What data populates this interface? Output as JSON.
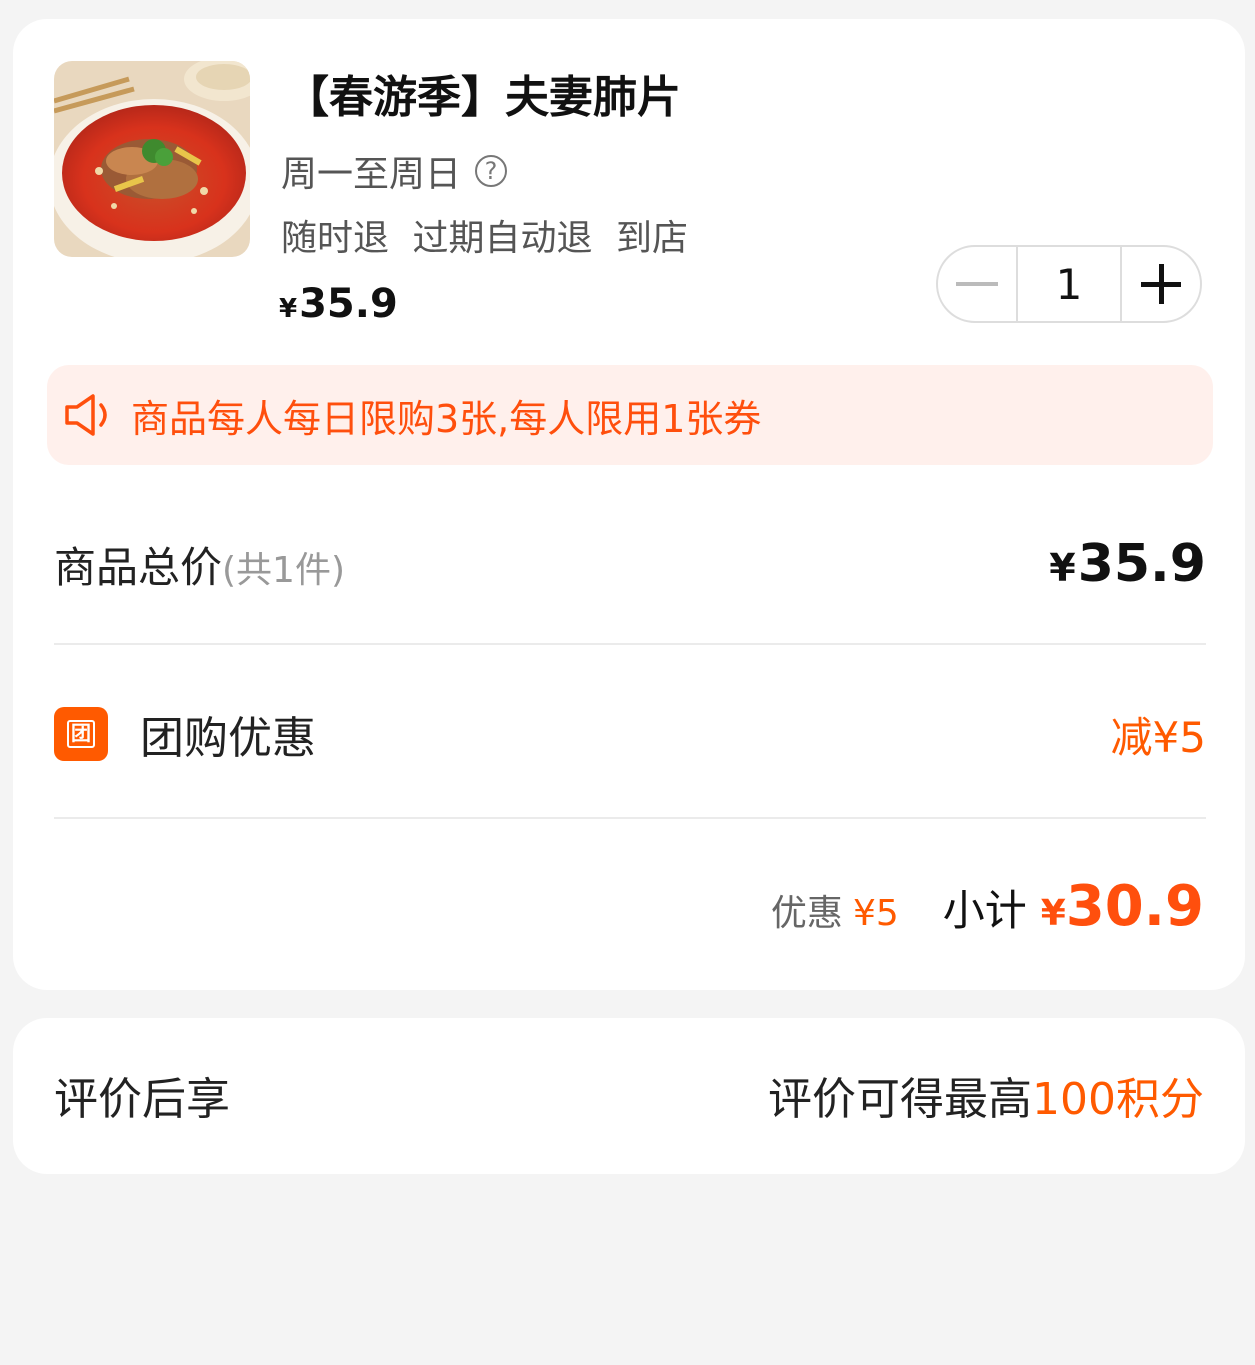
{
  "product": {
    "title": "【春游季】夫妻肺片",
    "validity": "周一至周日",
    "refund_tags": [
      "随时退",
      "过期自动退",
      "到店"
    ],
    "price_symbol": "¥",
    "price": "35.9",
    "quantity": "1",
    "image_icon": "food-photo"
  },
  "notice": {
    "text": "商品每人每日限购3张,每人限用1张券"
  },
  "total": {
    "label": "商品总价",
    "count": "(共1件)",
    "symbol": "¥",
    "value": "35.9"
  },
  "discount": {
    "icon_text": "团",
    "label": "团购优惠",
    "value": "减¥5"
  },
  "subtotal": {
    "discount_label": "优惠",
    "discount_value": "¥5",
    "label": "小计",
    "symbol": "¥",
    "value": "30.9"
  },
  "review": {
    "label": "评价后享",
    "value_prefix": "评价可得最高",
    "value_highlight": "100积分"
  },
  "colors": {
    "accent": "#ff5a00",
    "notice_bg": "#fff0ec"
  }
}
